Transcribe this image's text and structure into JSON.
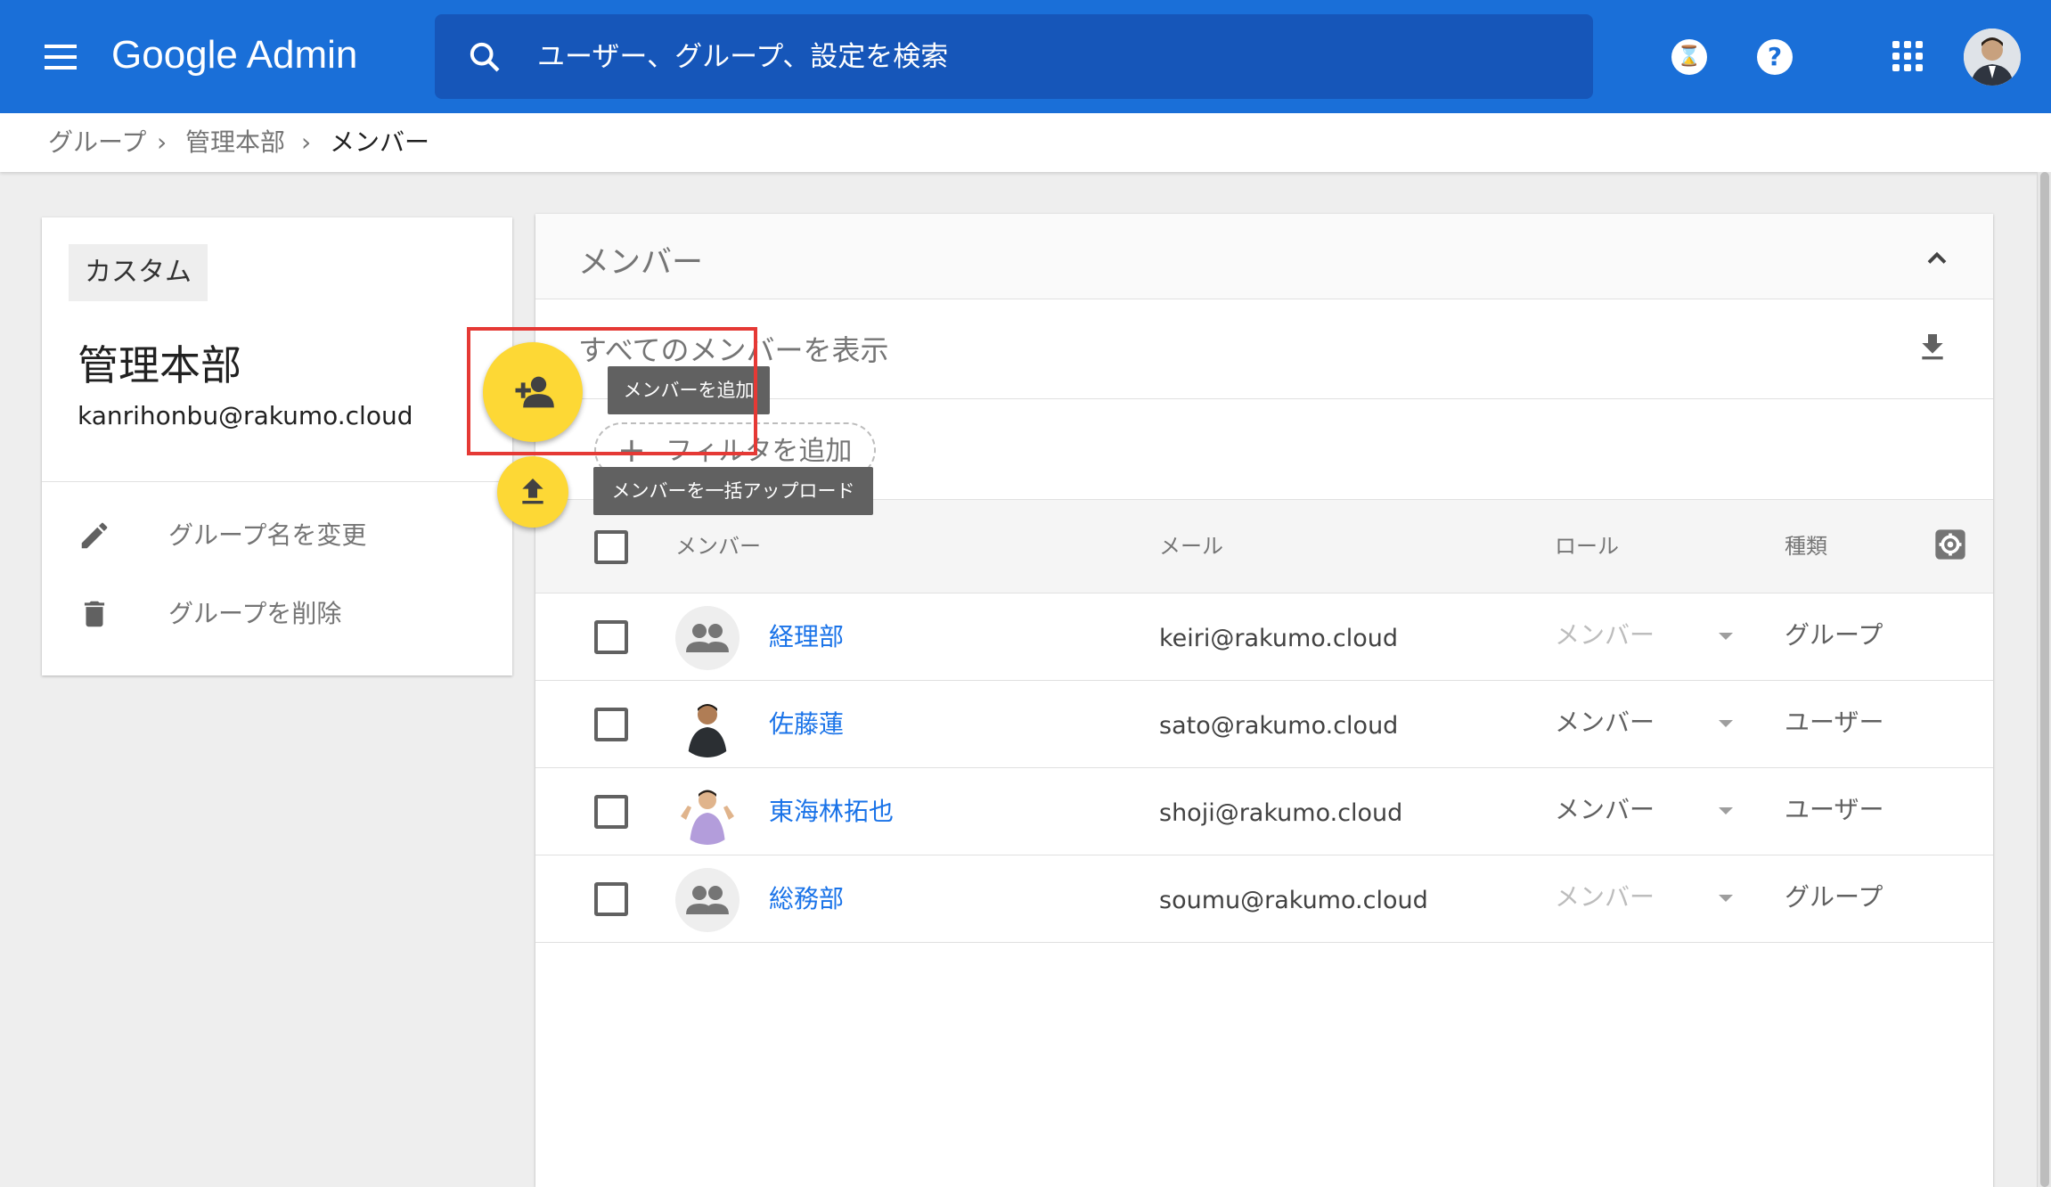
{
  "header": {
    "brand": "Google Admin",
    "search_placeholder": "ユーザー、グループ、設定を検索",
    "hourglass_glyph": "⌛",
    "help_glyph": "?",
    "color": "#1a6fd8"
  },
  "breadcrumb": {
    "items": [
      "グループ",
      "管理本部",
      "メンバー"
    ],
    "separator": "›"
  },
  "group_card": {
    "type_chip": "カスタム",
    "name": "管理本部",
    "email": "kanrihonbu@rakumo.cloud",
    "actions": [
      {
        "label": "グループ名を変更",
        "icon": "pencil-icon"
      },
      {
        "label": "グループを削除",
        "icon": "trash-icon"
      }
    ]
  },
  "fab": {
    "add_tooltip": "メンバーを追加",
    "upload_tooltip": "メンバーを一括アップロード",
    "color": "#fdd835"
  },
  "members_panel": {
    "title": "メンバー",
    "show_all": "すべてのメンバーを表示",
    "add_filter": "フィルタを追加",
    "filter_plus": "+",
    "columns": {
      "member": "メンバー",
      "email": "メール",
      "role": "ロール",
      "kind": "種類"
    },
    "rows": [
      {
        "name": "経理部",
        "email": "keiri@rakumo.cloud",
        "role": "メンバー",
        "role_muted": true,
        "kind": "グループ",
        "avatar": "group-icon"
      },
      {
        "name": "佐藤蓮",
        "email": "sato@rakumo.cloud",
        "role": "メンバー",
        "role_muted": false,
        "kind": "ユーザー",
        "avatar": "user-photo"
      },
      {
        "name": "東海林拓也",
        "email": "shoji@rakumo.cloud",
        "role": "メンバー",
        "role_muted": false,
        "kind": "ユーザー",
        "avatar": "user-photo"
      },
      {
        "name": "総務部",
        "email": "soumu@rakumo.cloud",
        "role": "メンバー",
        "role_muted": true,
        "kind": "グループ",
        "avatar": "group-icon"
      }
    ]
  },
  "colors": {
    "link": "#1a73e8",
    "highlight": "#e53935"
  }
}
